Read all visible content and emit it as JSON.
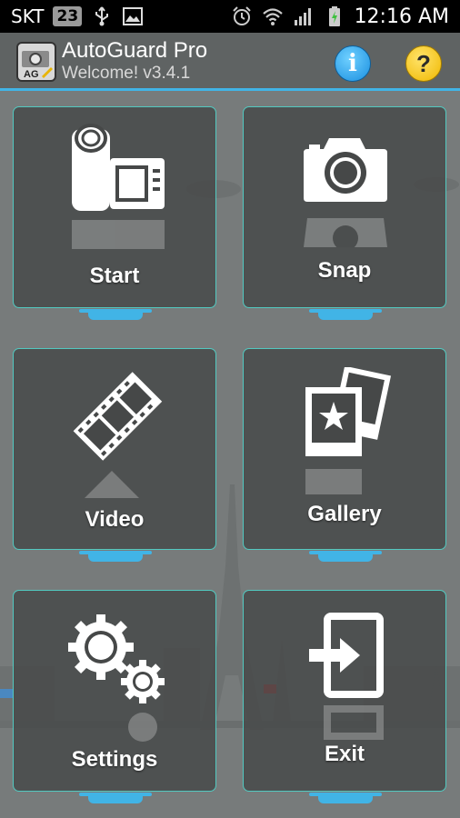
{
  "status_bar": {
    "carrier": "SKT",
    "notification_count": "23",
    "time": "12:16 AM",
    "icons": [
      "usb-icon",
      "image-icon",
      "alarm-icon",
      "wifi-icon",
      "signal-icon",
      "battery-charging-icon"
    ]
  },
  "app": {
    "title": "AutoGuard Pro",
    "subtitle": "Welcome! v3.4.1",
    "info_label": "i",
    "help_label": "?"
  },
  "tiles": [
    {
      "label": "Start",
      "icon": "video-camera-icon"
    },
    {
      "label": "Snap",
      "icon": "photo-camera-icon"
    },
    {
      "label": "Video",
      "icon": "film-strip-icon"
    },
    {
      "label": "Gallery",
      "icon": "gallery-star-icon"
    },
    {
      "label": "Settings",
      "icon": "gears-icon"
    },
    {
      "label": "Exit",
      "icon": "exit-door-icon"
    }
  ],
  "colors": {
    "accent": "#41b4e6",
    "tile_border": "#52c9c0",
    "tile_bg": "#464848",
    "background": "#777b7b"
  }
}
